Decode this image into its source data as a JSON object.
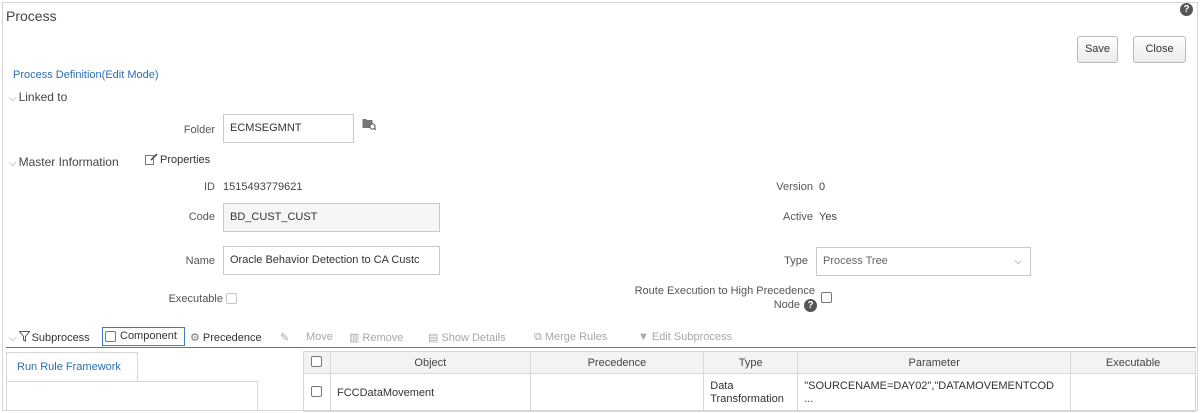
{
  "window": {
    "title": "Process",
    "help_glyph": "?"
  },
  "actions": {
    "save": "Save",
    "close": "Close"
  },
  "mode_link": "Process Definition(Edit Mode)",
  "sections": {
    "linked_to": "Linked to",
    "master_info": "Master Information",
    "properties": "Properties",
    "subprocess": "Subprocess"
  },
  "chevron": "⌵",
  "linked": {
    "folder_label": "Folder",
    "folder_value": "ECMSEGMNT"
  },
  "master": {
    "id_label": "ID",
    "id_value": "1515493779621",
    "version_label": "Version",
    "version_value": "0",
    "code_label": "Code",
    "code_value": "BD_CUST_CUST",
    "active_label": "Active",
    "active_value": "Yes",
    "name_label": "Name",
    "name_value": "Oracle Behavior Detection to CA Custc",
    "type_label": "Type",
    "type_value": "Process Tree",
    "executable_label": "Executable",
    "route_label_line1": "Route Execution to High Precedence",
    "route_label_line2": "Node"
  },
  "toolbar": {
    "component": "Component",
    "precedence": "Precedence",
    "move": "Move",
    "remove": "Remove",
    "show_details": "Show Details",
    "merge_rules": "Merge Rules",
    "edit_subprocess": "Edit Subprocess"
  },
  "tabs": {
    "run_rule_framework": "Run Rule Framework"
  },
  "grid": {
    "columns": [
      "Object",
      "Precedence",
      "Type",
      "Parameter",
      "Executable"
    ],
    "rows": [
      {
        "object": "FCCDataMovement",
        "precedence": "",
        "type_line1": "Data",
        "type_line2": "Transformation",
        "parameter_line1": "\"SOURCENAME=DAY02\",\"DATAMOVEMENTCOD",
        "parameter_line2": "...",
        "executable": ""
      }
    ]
  },
  "colors": {
    "accent_blue": "#2a6fb0",
    "focus_blue": "#3c7fc1"
  },
  "icons": {
    "folder_browse": "folder-browse-icon",
    "properties": "properties-edit-icon",
    "filter": "filter-icon",
    "precedence": "precedence-icon"
  }
}
